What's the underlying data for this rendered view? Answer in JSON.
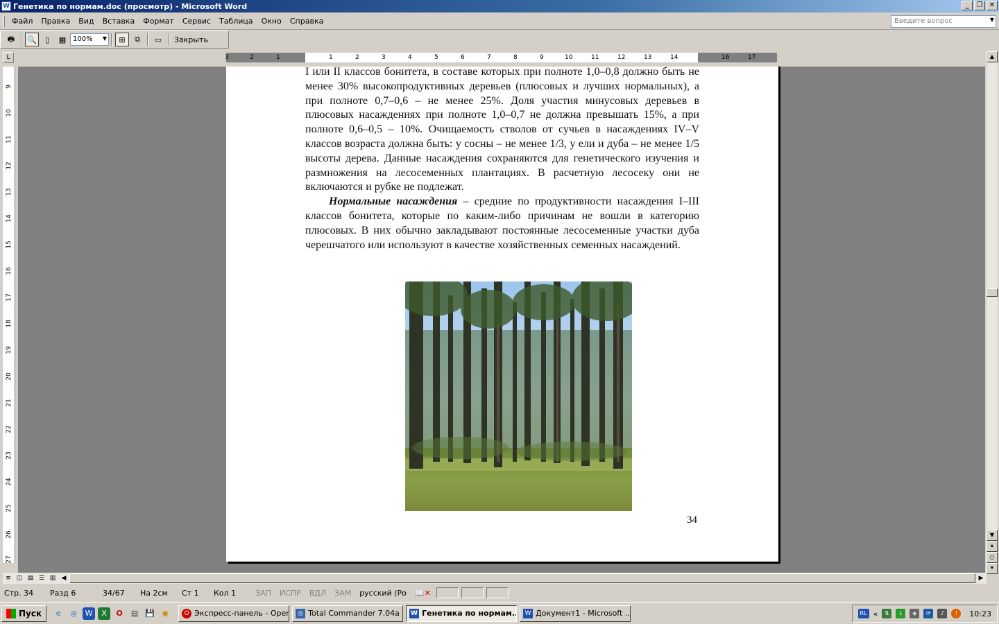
{
  "window": {
    "title": "Генетика по нормам.doc (просмотр) - Microsoft Word"
  },
  "menu": {
    "items": [
      "Файл",
      "Правка",
      "Вид",
      "Вставка",
      "Формат",
      "Сервис",
      "Таблица",
      "Окно",
      "Справка"
    ],
    "ask_placeholder": "Введите вопрос"
  },
  "toolbar": {
    "zoom": "100%",
    "close_label": "Закрыть"
  },
  "ruler": {
    "h_ticks": [
      "3",
      "2",
      "1",
      "1",
      "2",
      "3",
      "4",
      "5",
      "6",
      "7",
      "8",
      "9",
      "10",
      "11",
      "12",
      "13",
      "14",
      "16",
      "17"
    ],
    "v_ticks": [
      "9",
      "10",
      "11",
      "12",
      "13",
      "14",
      "15",
      "16",
      "17",
      "18",
      "19",
      "20",
      "21",
      "22",
      "23",
      "24",
      "25",
      "26",
      "27"
    ]
  },
  "document": {
    "paragraphs": [
      {
        "indent": false,
        "bold_lead": "",
        "text": "I или II классов бонитета, в составе которых при полноте 1,0–0,8 должно быть не менее 30% высокопродуктивных деревьев (плюсовых и лучших нормальных), а при полноте 0,7–0,6 – не менее 25%.  Доля участия минусовых деревьев в плюсовых насаждениях при полноте 1,0–0,7 не должна превышать 15%, а при полноте 0,6–0,5 – 10%. Очищаемость стволов от сучьев в насаждениях IV–V классов возраста должна быть: у сосны – не менее 1/3, у ели и дуба – не менее 1/5 высоты дерева. Данные насаждения сохраняются для генетического изучения и размножения на лесосеменных плантациях. В расчетную лесосеку они не включаются и рубке не подлежат."
      },
      {
        "indent": true,
        "bold_lead": "Нормальные насаждения",
        "text": " – средние по продуктивности насаждения I–III классов бонитета, которые по каким-либо причинам не вошли в категорию плюсовых. В них обычно закладывают постоянные лесосеменные участки дуба черешчатого или используют в качестве хозяйственных семенных насаждений."
      }
    ],
    "page_number": "34"
  },
  "status": {
    "page": "Стр. 34",
    "section": "Разд 6",
    "pages": "34/67",
    "at": "На 2см",
    "line": "Ст 1",
    "col": "Кол 1",
    "rec": "ЗАП",
    "trk": "ИСПР",
    "ext": "ВДЛ",
    "ovr": "ЗАМ",
    "lang": "русский (Ро"
  },
  "taskbar": {
    "start_label": "Пуск",
    "tasks": [
      {
        "label": "Экспресс-панель - Opera",
        "icon": "opera-icon",
        "color": "#cc0000"
      },
      {
        "label": "Total Commander 7.04a ...",
        "icon": "total-commander-icon",
        "color": "#3366aa"
      },
      {
        "label": "Генетика по нормам....",
        "icon": "word-icon",
        "color": "#2050b0",
        "active": true
      },
      {
        "label": "Документ1 - Microsoft ...",
        "icon": "word-icon",
        "color": "#2050b0"
      }
    ],
    "lang_indicator": "RL",
    "clock": "10:23"
  }
}
